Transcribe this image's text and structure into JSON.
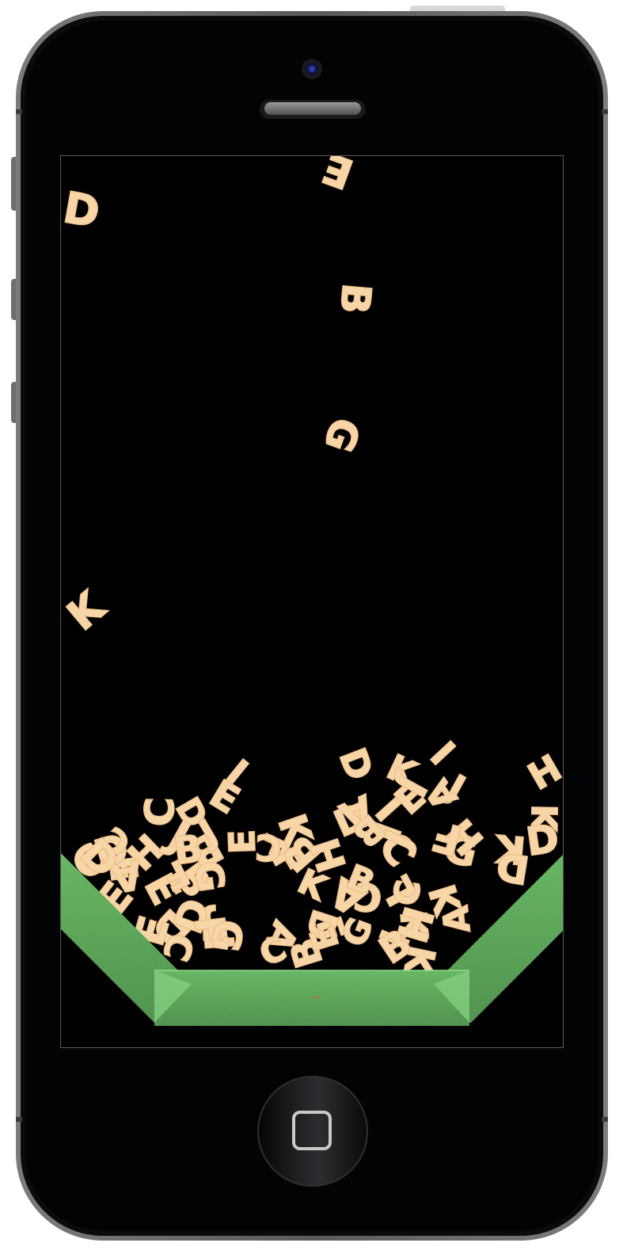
{
  "device": {
    "body_color": "#0b0c0e",
    "bezel_color": "#5b5b5b",
    "screen_border_color": "#5a5a5a"
  },
  "game": {
    "letter_fill": "#f7d5a6",
    "letter_stroke": "#e8b983",
    "letter_hole": "#a68450",
    "trough_color": "#4ea84a",
    "trough_light": "#79cf75",
    "falling_letters": [
      "E",
      "D",
      "B",
      "G",
      "K"
    ],
    "pile_letters": [
      "I",
      "L",
      "K",
      "J",
      "D",
      "E",
      "B",
      "F",
      "H",
      "K",
      "A",
      "F",
      "D",
      "E",
      "C",
      "D",
      "J",
      "G",
      "C",
      "F",
      "B",
      "K",
      "I",
      "J",
      "E",
      "A",
      "D",
      "F",
      "C",
      "H",
      "G",
      "B",
      "C",
      "K",
      "J",
      "E",
      "A",
      "D",
      "B",
      "I",
      "C",
      "K",
      "F",
      "E",
      "J",
      "D",
      "G",
      "C",
      "I",
      "K",
      "D",
      "A",
      "B",
      "C",
      "H",
      "E",
      "K",
      "I",
      "B",
      "D",
      "F",
      "E",
      "C",
      "G",
      "J",
      "A",
      "B",
      "D",
      "C",
      "K",
      "H",
      "E",
      "F",
      "A",
      "B",
      "D",
      "H"
    ]
  }
}
